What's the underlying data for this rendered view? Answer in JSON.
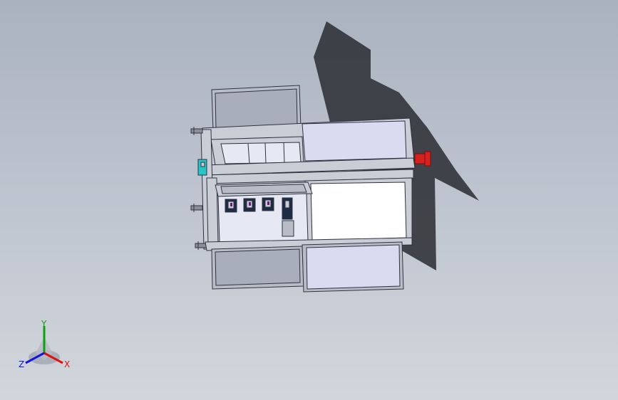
{
  "view": {
    "background_top": "#aab2bf",
    "background_bottom": "#d2d6dc",
    "shadow_color": "#2a2c31"
  },
  "model": {
    "frame_color": "#c9cdd6",
    "panel_color": "#d9dcf0",
    "edge_color": "#2f3340",
    "drawer_color": "#b7bcc7",
    "handle_color": "#d4231e",
    "fixture_color": "#1f2a44",
    "accent_cyan": "#27c4c8"
  },
  "triad": {
    "x_label": "X",
    "y_label": "Y",
    "z_label": "Z",
    "x_color": "#e01010",
    "y_color": "#10a010",
    "z_color": "#1515e0"
  }
}
